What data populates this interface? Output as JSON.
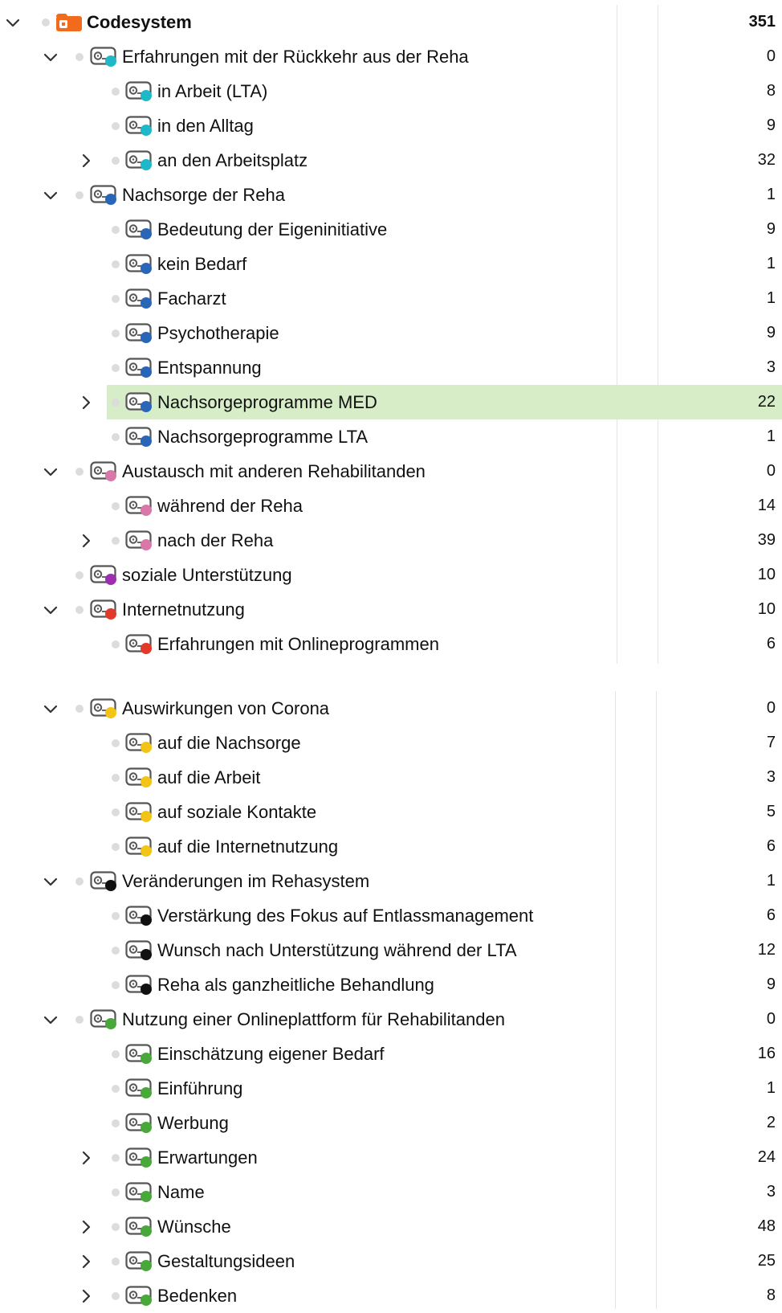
{
  "colors": {
    "teal": "#1fb8c9",
    "blue": "#2a66b7",
    "pink": "#d877a8",
    "purple": "#9b2fb0",
    "red": "#e23a2a",
    "yellow": "#f2c417",
    "black": "#111111",
    "green": "#49a83a",
    "root": "#f26a1c",
    "selection": "#d6edc8"
  },
  "panel1": [
    {
      "label": "Codesystem",
      "count": "351",
      "level": 0,
      "chevron": "down",
      "icon": "codesystem-icon",
      "color": "root",
      "root": true
    },
    {
      "label": "Erfahrungen mit der Rückkehr aus der Reha",
      "count": "0",
      "level": 1,
      "chevron": "down",
      "icon": "code-icon",
      "color": "teal"
    },
    {
      "label": "in Arbeit (LTA)",
      "count": "8",
      "level": 2,
      "chevron": "",
      "icon": "code-icon",
      "color": "teal"
    },
    {
      "label": "in den Alltag",
      "count": "9",
      "level": 2,
      "chevron": "",
      "icon": "code-icon",
      "color": "teal"
    },
    {
      "label": "an den Arbeitsplatz",
      "count": "32",
      "level": 2,
      "chevron": "right",
      "icon": "code-icon",
      "color": "teal"
    },
    {
      "label": "Nachsorge der Reha",
      "count": "1",
      "level": 1,
      "chevron": "down",
      "icon": "code-icon",
      "color": "blue"
    },
    {
      "label": "Bedeutung der Eigeninitiative",
      "count": "9",
      "level": 2,
      "chevron": "",
      "icon": "code-icon",
      "color": "blue"
    },
    {
      "label": "kein Bedarf",
      "count": "1",
      "level": 2,
      "chevron": "",
      "icon": "code-icon",
      "color": "blue"
    },
    {
      "label": "Facharzt",
      "count": "1",
      "level": 2,
      "chevron": "",
      "icon": "code-icon",
      "color": "blue"
    },
    {
      "label": "Psychotherapie",
      "count": "9",
      "level": 2,
      "chevron": "",
      "icon": "code-icon",
      "color": "blue"
    },
    {
      "label": "Entspannung",
      "count": "3",
      "level": 2,
      "chevron": "",
      "icon": "code-icon",
      "color": "blue"
    },
    {
      "label": "Nachsorgeprogramme MED",
      "count": "22",
      "level": 2,
      "chevron": "right",
      "icon": "code-icon",
      "color": "blue",
      "selected": true
    },
    {
      "label": "Nachsorgeprogramme LTA",
      "count": "1",
      "level": 2,
      "chevron": "",
      "icon": "code-icon",
      "color": "blue"
    },
    {
      "label": "Austausch mit anderen Rehabilitanden",
      "count": "0",
      "level": 1,
      "chevron": "down",
      "icon": "code-icon",
      "color": "pink"
    },
    {
      "label": "während der Reha",
      "count": "14",
      "level": 2,
      "chevron": "",
      "icon": "code-icon",
      "color": "pink"
    },
    {
      "label": "nach der Reha",
      "count": "39",
      "level": 2,
      "chevron": "right",
      "icon": "code-icon",
      "color": "pink"
    },
    {
      "label": "soziale Unterstützung",
      "count": "10",
      "level": 1,
      "chevron": "",
      "icon": "code-icon",
      "color": "purple"
    },
    {
      "label": "Internetnutzung",
      "count": "10",
      "level": 1,
      "chevron": "down",
      "icon": "code-icon",
      "color": "red"
    },
    {
      "label": "Erfahrungen mit Onlineprogrammen",
      "count": "6",
      "level": 2,
      "chevron": "",
      "icon": "code-icon",
      "color": "red"
    }
  ],
  "panel2": [
    {
      "label": "Auswirkungen von Corona",
      "count": "0",
      "level": 1,
      "chevron": "down",
      "icon": "code-icon",
      "color": "yellow"
    },
    {
      "label": "auf die Nachsorge",
      "count": "7",
      "level": 2,
      "chevron": "",
      "icon": "code-icon",
      "color": "yellow"
    },
    {
      "label": "auf die Arbeit",
      "count": "3",
      "level": 2,
      "chevron": "",
      "icon": "code-icon",
      "color": "yellow"
    },
    {
      "label": "auf soziale Kontakte",
      "count": "5",
      "level": 2,
      "chevron": "",
      "icon": "code-icon",
      "color": "yellow"
    },
    {
      "label": "auf die Internetnutzung",
      "count": "6",
      "level": 2,
      "chevron": "",
      "icon": "code-icon",
      "color": "yellow"
    },
    {
      "label": "Veränderungen im Rehasystem",
      "count": "1",
      "level": 1,
      "chevron": "down",
      "icon": "code-icon",
      "color": "black"
    },
    {
      "label": "Verstärkung des Fokus auf Entlassmanagement",
      "count": "6",
      "level": 2,
      "chevron": "",
      "icon": "code-icon",
      "color": "black"
    },
    {
      "label": "Wunsch nach Unterstützung während der LTA",
      "count": "12",
      "level": 2,
      "chevron": "",
      "icon": "code-icon",
      "color": "black"
    },
    {
      "label": "Reha als ganzheitliche Behandlung",
      "count": "9",
      "level": 2,
      "chevron": "",
      "icon": "code-icon",
      "color": "black"
    },
    {
      "label": "Nutzung einer Onlineplattform für Rehabilitanden",
      "count": "0",
      "level": 1,
      "chevron": "down",
      "icon": "code-icon",
      "color": "green"
    },
    {
      "label": "Einschätzung eigener Bedarf",
      "count": "16",
      "level": 2,
      "chevron": "",
      "icon": "code-icon",
      "color": "green"
    },
    {
      "label": "Einführung",
      "count": "1",
      "level": 2,
      "chevron": "",
      "icon": "code-icon",
      "color": "green"
    },
    {
      "label": "Werbung",
      "count": "2",
      "level": 2,
      "chevron": "",
      "icon": "code-icon",
      "color": "green"
    },
    {
      "label": "Erwartungen",
      "count": "24",
      "level": 2,
      "chevron": "right",
      "icon": "code-icon",
      "color": "green"
    },
    {
      "label": "Name",
      "count": "3",
      "level": 2,
      "chevron": "",
      "icon": "code-icon",
      "color": "green"
    },
    {
      "label": "Wünsche",
      "count": "48",
      "level": 2,
      "chevron": "right",
      "icon": "code-icon",
      "color": "green"
    },
    {
      "label": "Gestaltungsideen",
      "count": "25",
      "level": 2,
      "chevron": "right",
      "icon": "code-icon",
      "color": "green"
    },
    {
      "label": "Bedenken",
      "count": "8",
      "level": 2,
      "chevron": "right",
      "icon": "code-icon",
      "color": "green"
    }
  ]
}
